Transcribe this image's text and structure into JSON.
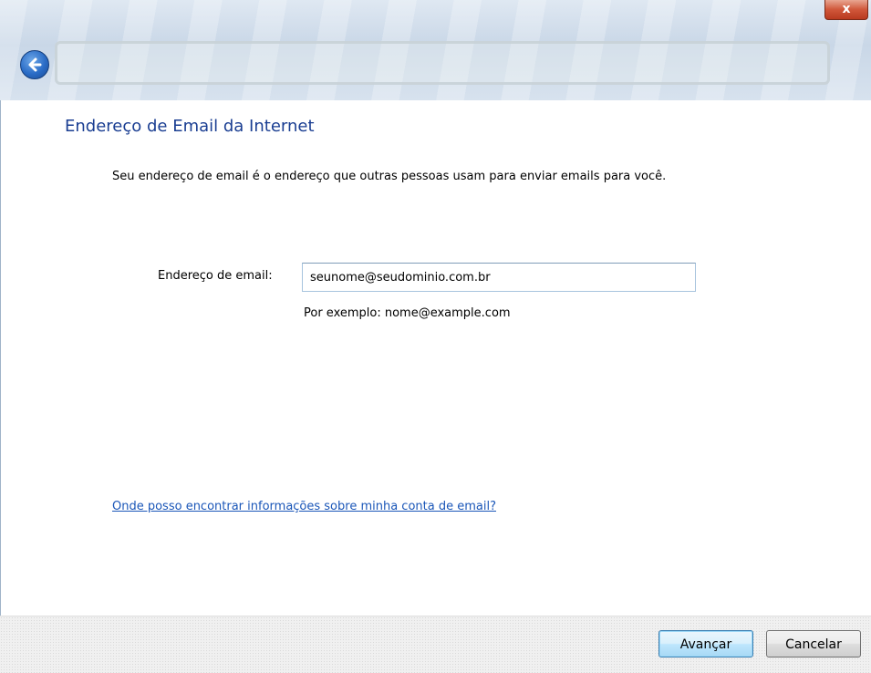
{
  "window": {
    "close_label": "x"
  },
  "content": {
    "heading": "Endereço de Email da Internet",
    "description": "Seu endereço de email é o endereço que outras pessoas usam para enviar emails para você.",
    "email_label": "Endereço de email:",
    "email_value": "seunome@seudominio.com.br",
    "example_hint": "Por exemplo: nome@example.com",
    "help_link": "Onde posso encontrar informações sobre minha conta de email?"
  },
  "footer": {
    "next_label": "Avançar",
    "cancel_label": "Cancelar"
  },
  "icons": {
    "back": "back-arrow-icon",
    "close": "close-icon"
  },
  "colors": {
    "heading": "#1a3e92",
    "link": "#1a56b8",
    "close_button": "#d0573a"
  }
}
